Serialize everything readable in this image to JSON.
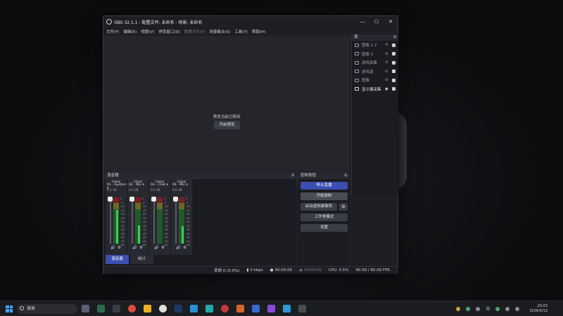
{
  "window": {
    "title": "OBS 32.1.1 - 配置文件: 未命名 - 场景: 未命名",
    "controls": [
      "—",
      "☐",
      "✕"
    ]
  },
  "menu": [
    "文件(F)",
    "编辑(E)",
    "视图(V)",
    "停靠窗口(D)",
    "配置文件(P)",
    "场景集合(S)",
    "工具(T)",
    "帮助(H)"
  ],
  "preview": {
    "message": "预览当前已禁用",
    "enable_button": "开启预览"
  },
  "sources": {
    "title": "源",
    "items": [
      {
        "label": "图像 2 2",
        "icon": "image-icon"
      },
      {
        "label": "图像 2",
        "icon": "image-icon"
      },
      {
        "label": "游戏采集",
        "icon": "gamepad-icon"
      },
      {
        "label": "游戏源",
        "icon": "cloud-icon"
      },
      {
        "label": "图像",
        "icon": "image-icon"
      },
      {
        "label": "显示器采集",
        "icon": "monitor-icon"
      }
    ]
  },
  "mixer": {
    "title": "混音器",
    "channels": [
      {
        "tag": "Global",
        "name": "01 - System",
        "db": "0.0 dB",
        "level": 0.72
      },
      {
        "tag": "Global",
        "name": "02 - Mic",
        "db": "0.0 dB",
        "level": 0.4
      },
      {
        "tag": "Global",
        "name": "03 - Chat",
        "db": "0.0 dB",
        "level": 0.0
      },
      {
        "tag": "Global",
        "name": "04 - Mic",
        "db": "0.0 dB",
        "level": 0.38
      }
    ],
    "scale": [
      "0",
      "-5",
      "-10",
      "-15",
      "-20",
      "-25",
      "-30",
      "-35",
      "-40",
      "-45",
      "-50",
      "-55",
      "-60"
    ],
    "tabs": [
      "混音器",
      "统计"
    ]
  },
  "controls": {
    "title": "控制按钮",
    "stop_stream": "停止直播",
    "start_recording": "开始录制",
    "virtual_camera": "启动虚拟摄像机",
    "studio_mode": "工作室模式",
    "settings": "设置"
  },
  "status": {
    "dropped": "丢帧 0 (0.0%)",
    "bitrate": "0 kbps",
    "stream_time": "00:00:00",
    "rec_time": "00:00:00",
    "cpu": "CPU: 0.5%",
    "fps": "60.00 / 60.00 FPS"
  },
  "taskbar": {
    "search_placeholder": "搜索",
    "ime": "中",
    "time": "20:03",
    "date": "2026/4/12"
  },
  "colors": {
    "accent": "#3a4fb0",
    "meter_green": "#3ecc52"
  }
}
